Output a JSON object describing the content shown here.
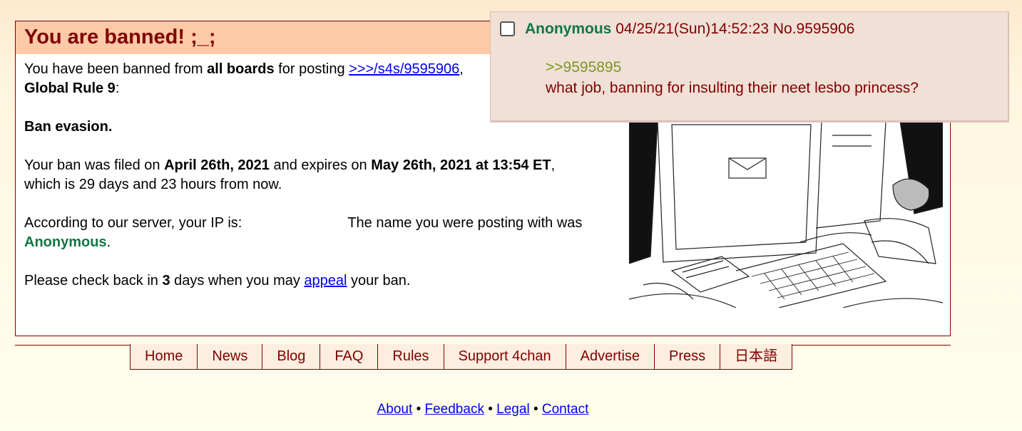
{
  "ban": {
    "title": "You are banned! ;_;",
    "line1_prefix": "You have been banned from ",
    "scope": "all boards",
    "line1_mid": " for posting ",
    "post_link": ">>>/s4s/9595906",
    "line1_comma": ",",
    "rule": "Global Rule 9",
    "rule_colon": ":",
    "reason": "Ban evasion.",
    "filed_prefix": "Your ban was filed on ",
    "filed_date": "April 26th, 2021",
    "expires_mid": " and expires on ",
    "expires_date": "May 26th, 2021 at 13:54 ET",
    "expires_comma": ",",
    "remaining": "which is 29 days and 23 hours from now.",
    "ip_text": "According to our server, your IP is:",
    "name_text": "The name you were posting with was",
    "name": "Anonymous",
    "name_period": ".",
    "appeal_prefix": "Please check back in ",
    "appeal_days": "3",
    "appeal_mid": " days when you may ",
    "appeal_link": "appeal",
    "appeal_suffix": " your ban."
  },
  "nav": {
    "items": [
      "Home",
      "News",
      "Blog",
      "FAQ",
      "Rules",
      "Support 4chan",
      "Advertise",
      "Press",
      "日本語"
    ]
  },
  "footer": {
    "links": [
      "About",
      "Feedback",
      "Legal",
      "Contact"
    ],
    "separator": "•"
  },
  "popup": {
    "name": "Anonymous",
    "datetime": "04/25/21(Sun)14:52:23",
    "post_no": "No.9595906",
    "quote": ">>9595895",
    "message": "what job, banning for insulting their neet lesbo princess?"
  },
  "colors": {
    "ban_header_bg": "#fec9a6",
    "ban_title": "#800000",
    "name_green": "#117743",
    "quote_green": "#789922",
    "popup_bg": "#f0e0d6"
  },
  "icons": {
    "ban_image": "sketch-computer-desk-image",
    "post_checkbox": "checkbox"
  }
}
